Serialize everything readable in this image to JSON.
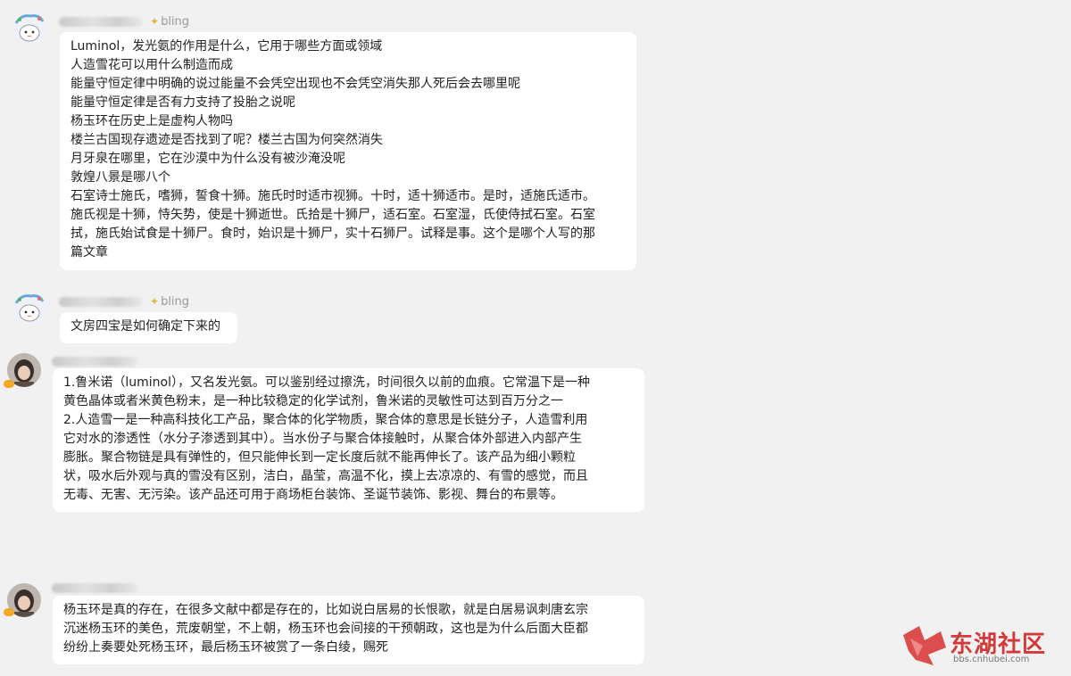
{
  "messages": [
    {
      "badge": "bling",
      "lines": [
        "Luminol，发光氨的作用是什么，它用于哪些方面或领域",
        "人造雪花可以用什么制造而成",
        "能量守恒定律中明确的说过能量不会凭空出现也不会凭空消失那人死后会去哪里呢",
        "能量守恒定律是否有力支持了投胎之说呢",
        "杨玉环在历史上是虚构人物吗",
        "楼兰古国现存遗迹是否找到了呢？楼兰古国为何突然消失",
        "月牙泉在哪里，它在沙漠中为什么没有被沙淹没呢",
        "敦煌八景是哪八个",
        "石室诗士施氏，嗜狮，誓食十狮。施氏时时适市视狮。十时，适十狮适市。是时，适施氏适市。",
        "施氏视是十狮，恃矢势，使是十狮逝世。氏拾是十狮尸，适石室。石室湿，氏使侍拭石室。石室",
        "拭，施氏始试食是十狮尸。食时，始识是十狮尸，实十石狮尸。试释是事。这个是哪个人写的那",
        "篇文章"
      ]
    },
    {
      "badge": "bling",
      "lines": [
        "文房四宝是如何确定下来的"
      ]
    },
    {
      "lines": [
        "1.鲁米诺（luminol），又名发光氨。可以鉴别经过擦洗，时间很久以前的血痕。它常温下是一种",
        "黄色晶体或者米黄色粉末，是一种比较稳定的化学试剂，鲁米诺的灵敏性可达到百万分之一",
        "2.人造雪一是一种高科技化工产品，聚合体的化学物质，聚合体的意思是长链分子，人造雪利用",
        "它对水的渗透性（水分子渗透到其中）。当水份子与聚合体接触时，从聚合体外部进入内部产生",
        "膨胀。聚合物链是具有弹性的，但只能伸长到一定长度后就不能再伸长了。该产品为细小颗粒",
        "状，吸水后外观与真的雪没有区别，洁白，晶莹，高温不化，摸上去凉凉的、有雪的感觉，而且",
        "无毒、无害、无污染。该产品还可用于商场柜台装饰、圣诞节装饰、影视、舞台的布景等。"
      ]
    },
    {
      "lines": [
        "杨玉环是真的存在，在很多文献中都是存在的，比如说白居易的长恨歌，就是白居易讽刺唐玄宗",
        "沉迷杨玉环的美色，荒废朝堂，不上朝，杨玉环也会间接的干预朝政，这也是为什么后面大臣都",
        "纷纷上奏要处死杨玉环，最后杨玉环被赏了一条白绫，赐死"
      ]
    }
  ],
  "logo": {
    "text": "东湖社区",
    "url": "bbs.cnhubei.com"
  },
  "colors": {
    "background": "#f1f1f1",
    "bubble": "#ffffff",
    "logo": "#d23a3a",
    "badge_star": "#e4b63a"
  },
  "icons": {
    "badge": "star-icon"
  }
}
